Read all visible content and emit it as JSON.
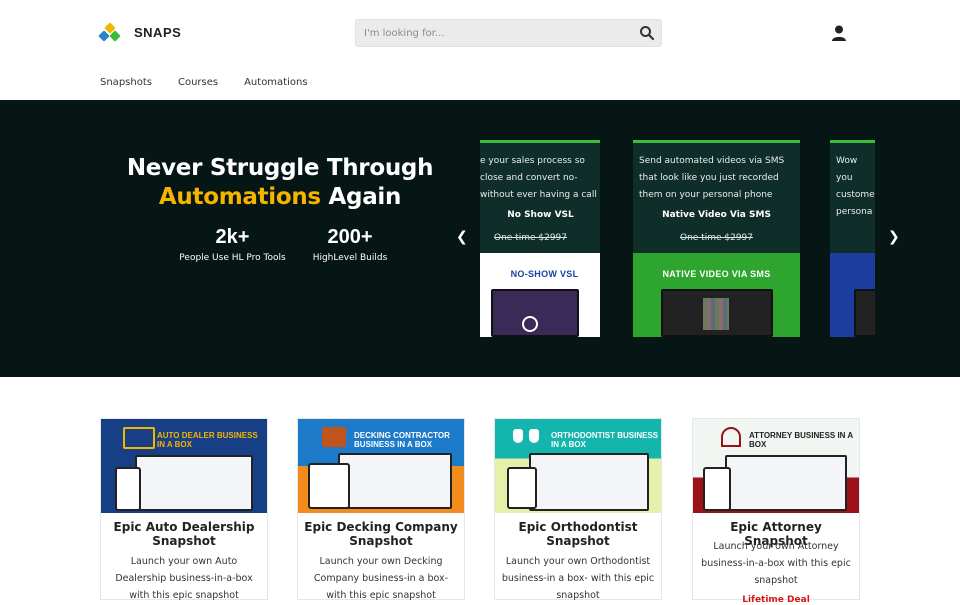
{
  "header": {
    "brand": "SNAPS",
    "search_placeholder": "I'm looking for...",
    "nav": [
      "Snapshots",
      "Courses",
      "Automations"
    ]
  },
  "hero": {
    "title_line1": "Never Struggle Through",
    "title_accent": "Automations",
    "title_rest": " Again",
    "stats": [
      {
        "num": "2k+",
        "label": "People Use HL Pro Tools"
      },
      {
        "num": "200+",
        "label": "HighLevel Builds"
      }
    ],
    "slides": [
      {
        "desc": "e your sales process so close and convert no- without ever having a call",
        "name": "No Show VSL",
        "price": "One time $2997",
        "thumb": "NO-SHOW VSL"
      },
      {
        "desc": "Send automated videos via SMS that look like you just recorded them on your personal phone",
        "name": "Native Video Via SMS",
        "price": "One time $2997",
        "thumb": "NATIVE VIDEO VIA SMS"
      },
      {
        "desc": "Wow you custome persona",
        "name": "",
        "price": "",
        "thumb": ""
      }
    ]
  },
  "products": [
    {
      "img_label": "Auto Dealer Business in a Box",
      "title": "Epic Auto Dealership Snapshot",
      "text": "Launch your own Auto Dealership business-in-a-box with this epic snapshot",
      "deal": ""
    },
    {
      "img_label": "Decking Contractor Business in a Box",
      "title": "Epic Decking Company Snapshot",
      "text": "Launch your own Decking Company business-in a box- with this epic snapshot",
      "deal": ""
    },
    {
      "img_label": "Orthodontist Business in a Box",
      "title": "Epic Orthodontist Snapshot",
      "text": "Launch your own Orthodontist business-in a box- with this epic snapshot",
      "deal": ""
    },
    {
      "img_label": "Attorney Business in a Box",
      "title": "Epic Attorney Snapshot",
      "text": "Launch your own Attorney business-in-a-box with this epic snapshot",
      "deal": "Lifetime Deal"
    }
  ],
  "colors": {
    "hero_bg": "#061614",
    "accent": "#f4b400",
    "slide_border": "#3bbd3c",
    "deal": "#d21a1a"
  }
}
